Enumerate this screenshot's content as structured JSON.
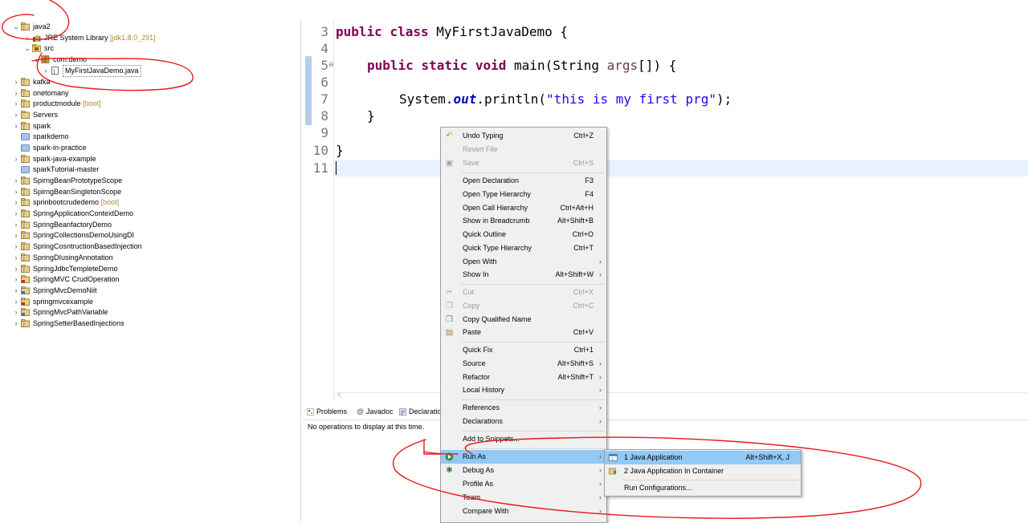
{
  "explorer": {
    "items": [
      {
        "twisty": "⌄",
        "label": "java2",
        "decoration": ""
      },
      {
        "twisty": "›",
        "label": "JRE System Library",
        "decoration": "[jdk1.8.0_291]"
      },
      {
        "twisty": "⌄",
        "label": "src",
        "decoration": ""
      },
      {
        "twisty": "⌄",
        "label": "com.demo",
        "decoration": ""
      },
      {
        "twisty": "›",
        "label": "MyFirstJavaDemo.java",
        "decoration": ""
      },
      {
        "twisty": "›",
        "label": "kafka",
        "decoration": ""
      },
      {
        "twisty": "›",
        "label": "onetomany",
        "decoration": ""
      },
      {
        "twisty": "›",
        "label": "productmodule",
        "decoration": "[boot]"
      },
      {
        "twisty": "›",
        "label": "Servers",
        "decoration": ""
      },
      {
        "twisty": "›",
        "label": "spark",
        "decoration": ""
      },
      {
        "twisty": "",
        "label": "sparkdemo",
        "decoration": ""
      },
      {
        "twisty": "",
        "label": "spark-in-practice",
        "decoration": ""
      },
      {
        "twisty": "›",
        "label": "spark-java-example",
        "decoration": ""
      },
      {
        "twisty": "",
        "label": "sparkTutorial-master",
        "decoration": ""
      },
      {
        "twisty": "›",
        "label": "SpirngBeanPrototypeScope",
        "decoration": ""
      },
      {
        "twisty": "›",
        "label": "SpirngBeanSingletonScope",
        "decoration": ""
      },
      {
        "twisty": "›",
        "label": "sprinbootcrudedemo",
        "decoration": "[boot]"
      },
      {
        "twisty": "›",
        "label": "SpringApplicationContextDemo",
        "decoration": ""
      },
      {
        "twisty": "›",
        "label": "SpringBeanfactoryDemo",
        "decoration": ""
      },
      {
        "twisty": "›",
        "label": "SpringCollectionsDemoUsingDI",
        "decoration": ""
      },
      {
        "twisty": "›",
        "label": "SpringCosntructionBasedInjection",
        "decoration": ""
      },
      {
        "twisty": "›",
        "label": "SpringDIusingAnnotation",
        "decoration": ""
      },
      {
        "twisty": "›",
        "label": "SpringJdbcTempleteDemo",
        "decoration": ""
      },
      {
        "twisty": "›",
        "label": "SpringMVC CrudOperation",
        "decoration": ""
      },
      {
        "twisty": "›",
        "label": "SpringMvcDemoNiit",
        "decoration": ""
      },
      {
        "twisty": "›",
        "label": "springmvcexample",
        "decoration": ""
      },
      {
        "twisty": "›",
        "label": "SpringMvcPathVariable",
        "decoration": ""
      },
      {
        "twisty": "›",
        "label": "SpringSetterBasedInjections",
        "decoration": ""
      }
    ]
  },
  "editor": {
    "lines": [
      {
        "num": "3",
        "code": "public class MyFirstJavaDemo {"
      },
      {
        "num": "4",
        "code": ""
      },
      {
        "num": "5",
        "code": "    public static void main(String args[]) {"
      },
      {
        "num": "6",
        "code": ""
      },
      {
        "num": "7",
        "code": "        System.out.println(\"this is my first prg\");"
      },
      {
        "num": "8",
        "code": "    }"
      },
      {
        "num": "9",
        "code": ""
      },
      {
        "num": "10",
        "code": "}"
      },
      {
        "num": "11",
        "code": ""
      }
    ],
    "tokens": {
      "public": "public",
      "class": "class",
      "class_name": " MyFirstJavaDemo {",
      "static": "static",
      "void": "void",
      "main_sig": " main(String ",
      "args": "args",
      "main_end": "[]) {",
      "system": "System.",
      "out": "out",
      "println": ".println(",
      "string": "\"this is my first prg\"",
      "stmt_end": ");",
      "close_method": "}",
      "close_class": "}"
    },
    "fold_marker": "⊖"
  },
  "bottom_tabs": {
    "problems": "Problems",
    "javadoc": "Javadoc",
    "declaration": "Declaratio",
    "message": "No operations to display at this time."
  },
  "context_menu": {
    "items": [
      {
        "label": "Undo Typing",
        "shortcut": "Ctrl+Z",
        "icon": "undo-icon"
      },
      {
        "label": "Revert File",
        "shortcut": "",
        "icon": ""
      },
      {
        "label": "Save",
        "shortcut": "Ctrl+S",
        "icon": "save-icon"
      },
      {
        "label": "Open Declaration",
        "shortcut": "F3"
      },
      {
        "label": "Open Type Hierarchy",
        "shortcut": "F4"
      },
      {
        "label": "Open Call Hierarchy",
        "shortcut": "Ctrl+Alt+H"
      },
      {
        "label": "Show in Breadcrumb",
        "shortcut": "Alt+Shift+B"
      },
      {
        "label": "Quick Outline",
        "shortcut": "Ctrl+O"
      },
      {
        "label": "Quick Type Hierarchy",
        "shortcut": "Ctrl+T"
      },
      {
        "label": "Open With",
        "shortcut": ""
      },
      {
        "label": "Show In",
        "shortcut": "Alt+Shift+W"
      },
      {
        "label": "Cut",
        "shortcut": "Ctrl+X",
        "icon": "cut-icon"
      },
      {
        "label": "Copy",
        "shortcut": "Ctrl+C",
        "icon": "copy-icon"
      },
      {
        "label": "Copy Qualified Name",
        "shortcut": "",
        "icon": "copy-qualified-name-icon"
      },
      {
        "label": "Paste",
        "shortcut": "Ctrl+V",
        "icon": "paste-icon"
      },
      {
        "label": "Quick Fix",
        "shortcut": "Ctrl+1"
      },
      {
        "label": "Source",
        "shortcut": "Alt+Shift+S"
      },
      {
        "label": "Refactor",
        "shortcut": "Alt+Shift+T"
      },
      {
        "label": "Local History",
        "shortcut": ""
      },
      {
        "label": "References",
        "shortcut": ""
      },
      {
        "label": "Declarations",
        "shortcut": ""
      },
      {
        "label": "Add to Snippets...",
        "shortcut": ""
      },
      {
        "label": "Run As",
        "shortcut": "",
        "icon": "run-icon"
      },
      {
        "label": "Debug As",
        "shortcut": "",
        "icon": "debug-icon"
      },
      {
        "label": "Profile As",
        "shortcut": ""
      },
      {
        "label": "Team",
        "shortcut": ""
      },
      {
        "label": "Compare With",
        "shortcut": ""
      }
    ],
    "arrow": "›"
  },
  "submenu": {
    "items": [
      {
        "label": "1 Java Application",
        "shortcut": "Alt+Shift+X, J",
        "icon": "java-application-icon"
      },
      {
        "label": "2 Java Application In Container",
        "shortcut": "",
        "icon": "java-container-icon"
      },
      {
        "label": "Run Configurations...",
        "shortcut": ""
      }
    ]
  },
  "colors": {
    "keyword": "#7f0055",
    "string": "#2a00ff",
    "static_field": "#0000c0",
    "highlight": "#91c9f7",
    "annotation": "#e8181c"
  }
}
